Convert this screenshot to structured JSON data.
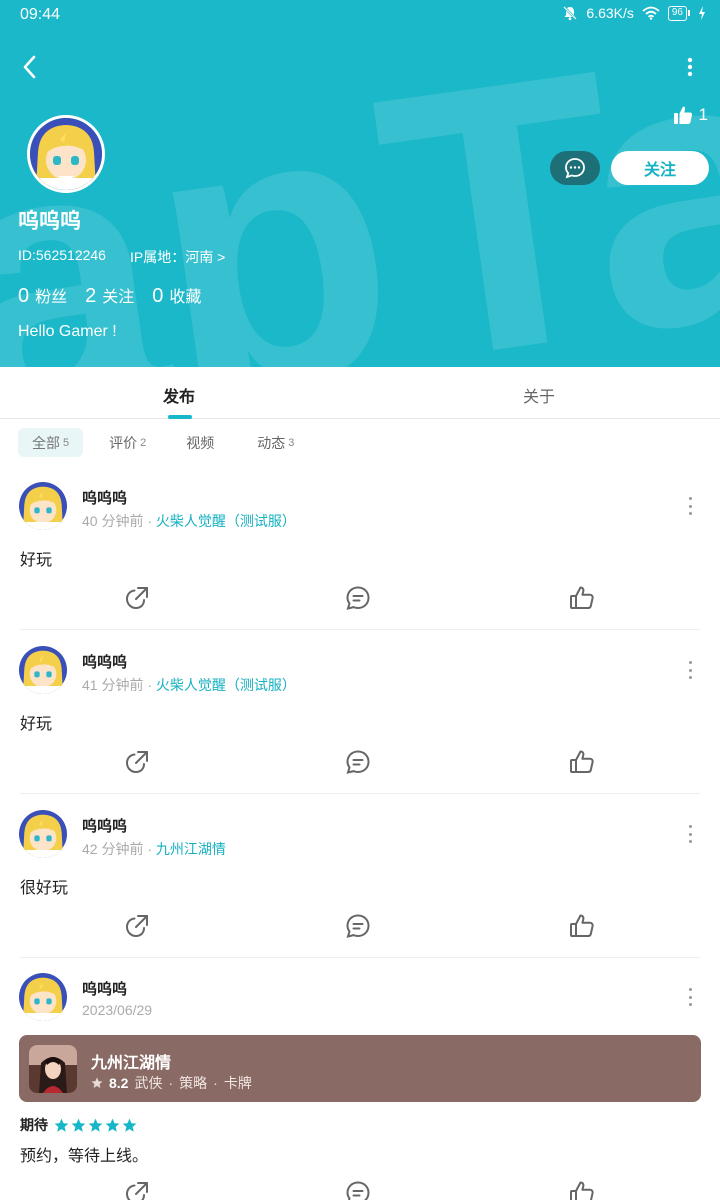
{
  "status_bar": {
    "time": "09:44",
    "speed": "6.63K/s",
    "battery": "96"
  },
  "profile": {
    "name": "呜呜呜",
    "id": "ID:562512246",
    "ip": "IP属地：河南 >",
    "likes": "1",
    "follow_label": "关注",
    "followers": {
      "count": "0",
      "label": "粉丝"
    },
    "following": {
      "count": "2",
      "label": "关注"
    },
    "favorites": {
      "count": "0",
      "label": "收藏"
    },
    "bio": "Hello Gamer !"
  },
  "tabs": [
    {
      "label": "发布"
    },
    {
      "label": "关于"
    }
  ],
  "filters": [
    {
      "label": "全部",
      "count": "5"
    },
    {
      "label": "评价",
      "count": "2"
    },
    {
      "label": "视频",
      "count": ""
    },
    {
      "label": "动态",
      "count": "3"
    }
  ],
  "posts": [
    {
      "name": "呜呜呜",
      "time": "40 分钟前",
      "sep": " · ",
      "game": "火柴人觉醒（测试服）",
      "text": "好玩"
    },
    {
      "name": "呜呜呜",
      "time": "41 分钟前",
      "sep": " · ",
      "game": "火柴人觉醒（测试服）",
      "text": "好玩"
    },
    {
      "name": "呜呜呜",
      "time": "42 分钟前",
      "sep": " · ",
      "game": "九州江湖情",
      "text": "很好玩"
    },
    {
      "name": "呜呜呜",
      "time": "2023/06/29",
      "card": {
        "title": "九州江湖情",
        "rating": "8.2",
        "tags": [
          "武侠",
          "策略",
          "卡牌"
        ]
      },
      "expect_label": "期待",
      "stars": 5,
      "text": "预约，等待上线。"
    }
  ],
  "colors": {
    "header": "#1ab8c9",
    "accent": "#16b7c8",
    "card": "#8a6a64"
  }
}
